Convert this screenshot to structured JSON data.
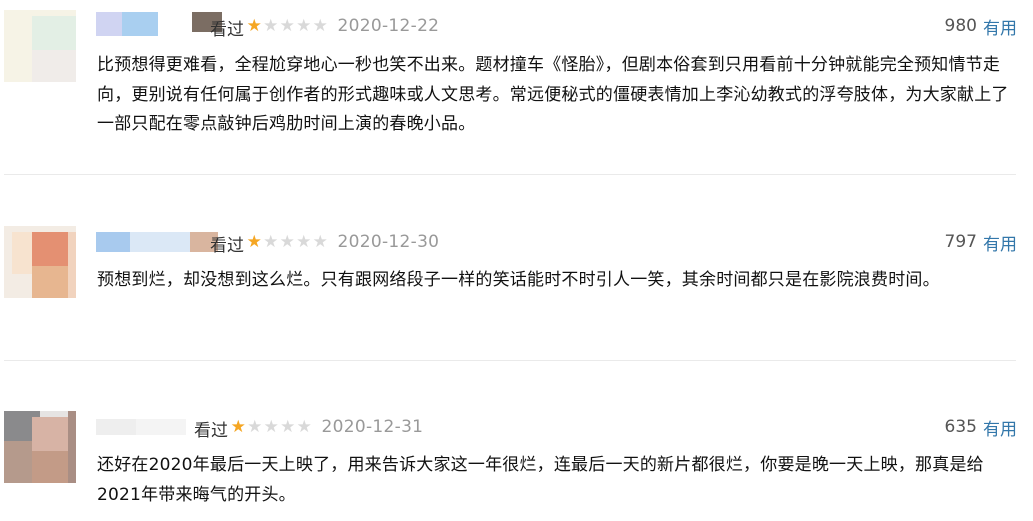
{
  "reviews": [
    {
      "watched_label": "看过",
      "rating": 1,
      "max_rating": 5,
      "date": "2020-12-22",
      "votes": "980",
      "useful_label": "有用",
      "text": "比预想得更难看，全程尬穿地心一秒也笑不出来。题材撞车《怪胎》，但剧本俗套到只用看前十分钟就能完全预知情节走向，更别说有任何属于创作者的形式趣味或人文思考。常远便秘式的僵硬表情加上李沁幼教式的浮夸肢体，为大家献上了一部只配在零点敲钟后鸡肋时间上演的春晚小品。"
    },
    {
      "watched_label": "看过",
      "rating": 1,
      "max_rating": 5,
      "date": "2020-12-30",
      "votes": "797",
      "useful_label": "有用",
      "text": "预想到烂，却没想到这么烂。只有跟网络段子一样的笑话能时不时引人一笑，其余时间都只是在影院浪费时间。"
    },
    {
      "watched_label": "看过",
      "rating": 1,
      "max_rating": 5,
      "date": "2020-12-31",
      "votes": "635",
      "useful_label": "有用",
      "text": "还好在2020年最后一天上映了，用来告诉大家这一年很烂，连最后一天的新片都很烂，你要是晚一天上映，那真是给2021年带来晦气的开头。"
    }
  ],
  "colors": {
    "star_on": "#f5a623",
    "star_off": "#d9d9d9",
    "date": "#999999",
    "useful_link": "#3377aa",
    "divider": "#eaeaea"
  }
}
